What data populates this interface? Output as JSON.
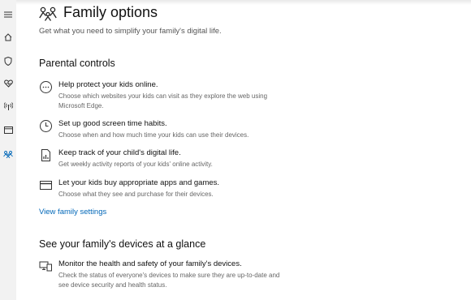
{
  "header": {
    "title": "Family options",
    "subtitle": "Get what you need to simplify your family's digital life.",
    "icon": "family-icon"
  },
  "sidebar": {
    "items": [
      {
        "name": "menu",
        "icon": "hamburger-menu-icon"
      },
      {
        "name": "home",
        "icon": "home-icon"
      },
      {
        "name": "virus-protection",
        "icon": "shield-icon"
      },
      {
        "name": "device-performance",
        "icon": "heart-pulse-icon"
      },
      {
        "name": "firewall-network",
        "icon": "wireless-antenna-icon"
      },
      {
        "name": "app-browser-control",
        "icon": "browser-window-icon"
      },
      {
        "name": "family-options",
        "icon": "family-icon",
        "active": true
      }
    ],
    "accent_color": "#0067b8"
  },
  "parental_controls": {
    "heading": "Parental controls",
    "items": [
      {
        "icon": "globe-dots-icon",
        "title": "Help protect your kids online.",
        "description": "Choose which websites your kids can visit as they explore the web using Microsoft Edge."
      },
      {
        "icon": "clock-icon",
        "title": "Set up good screen time habits.",
        "description": "Choose when and how much time your kids can use their devices."
      },
      {
        "icon": "activity-report-icon",
        "title": "Keep track of your child's digital life.",
        "description": "Get weekly activity reports of your kids' online activity."
      },
      {
        "icon": "credit-card-icon",
        "title": "Let your kids buy appropriate apps and games.",
        "description": "Choose what they see and purchase for their devices."
      }
    ],
    "link": "View family settings"
  },
  "devices": {
    "heading": "See your family's devices at a glance",
    "items": [
      {
        "icon": "devices-icon",
        "title": "Monitor the health and safety of your family's devices.",
        "description": "Check the status of everyone's devices to make sure they are up-to-date and see device security and health status."
      }
    ]
  }
}
